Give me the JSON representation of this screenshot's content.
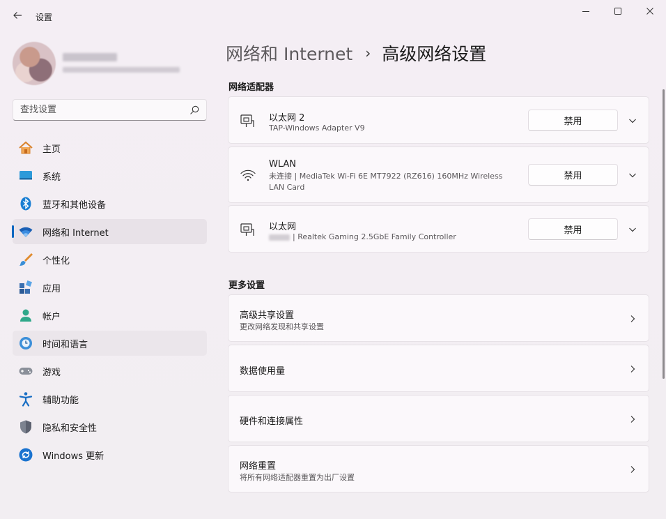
{
  "window": {
    "app_title": "设置",
    "controls": [
      "minimize",
      "maximize",
      "close"
    ]
  },
  "search": {
    "placeholder": "查找设置"
  },
  "sidebar": {
    "items": [
      {
        "label": "主页",
        "icon": "home-icon"
      },
      {
        "label": "系统",
        "icon": "system-icon"
      },
      {
        "label": "蓝牙和其他设备",
        "icon": "bluetooth-icon"
      },
      {
        "label": "网络和 Internet",
        "icon": "wifi-icon",
        "selected": true
      },
      {
        "label": "个性化",
        "icon": "brush-icon"
      },
      {
        "label": "应用",
        "icon": "apps-icon"
      },
      {
        "label": "帐户",
        "icon": "account-icon"
      },
      {
        "label": "时间和语言",
        "icon": "clock-globe-icon",
        "hovered": true
      },
      {
        "label": "游戏",
        "icon": "gamepad-icon"
      },
      {
        "label": "辅助功能",
        "icon": "accessibility-icon"
      },
      {
        "label": "隐私和安全性",
        "icon": "shield-icon"
      },
      {
        "label": "Windows 更新",
        "icon": "update-icon"
      }
    ]
  },
  "breadcrumb": {
    "parent": "网络和 Internet",
    "separator": "›",
    "current": "高级网络设置"
  },
  "adapters": {
    "section_title": "网络适配器",
    "items": [
      {
        "name": "以太网 2",
        "description": "TAP-Windows Adapter V9",
        "button": "禁用",
        "icon": "ethernet-icon"
      },
      {
        "name": "WLAN",
        "description_line1": "未连接 | MediaTek Wi-Fi 6E MT7922 (RZ616) 160MHz Wireless",
        "description_line2": "LAN Card",
        "button": "禁用",
        "icon": "wifi-icon"
      },
      {
        "name": "以太网",
        "description": "| Realtek Gaming 2.5GbE Family Controller",
        "button": "禁用",
        "icon": "ethernet-icon"
      }
    ]
  },
  "more_settings": {
    "section_title": "更多设置",
    "items": [
      {
        "title": "高级共享设置",
        "subtitle": "更改网络发现和共享设置"
      },
      {
        "title": "数据使用量",
        "subtitle": ""
      },
      {
        "title": "硬件和连接属性",
        "subtitle": ""
      },
      {
        "title": "网络重置",
        "subtitle": "将所有网络适配器重置为出厂设置"
      }
    ]
  },
  "colors": {
    "accent": "#0067c0",
    "background": "#f3eef3",
    "card": "#fbf8fb"
  }
}
